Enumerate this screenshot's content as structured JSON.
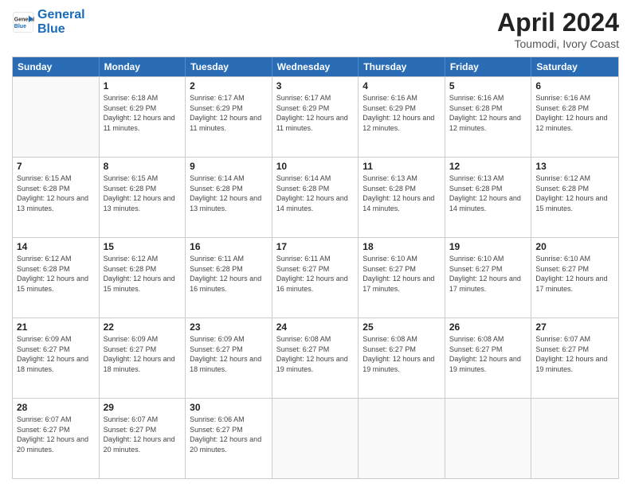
{
  "logo": {
    "line1": "General",
    "line2": "Blue"
  },
  "title": {
    "month": "April 2024",
    "location": "Toumodi, Ivory Coast"
  },
  "header_days": [
    "Sunday",
    "Monday",
    "Tuesday",
    "Wednesday",
    "Thursday",
    "Friday",
    "Saturday"
  ],
  "weeks": [
    [
      {
        "day": "",
        "sunrise": "",
        "sunset": "",
        "daylight": ""
      },
      {
        "day": "1",
        "sunrise": "6:18 AM",
        "sunset": "6:29 PM",
        "daylight": "12 hours and 11 minutes."
      },
      {
        "day": "2",
        "sunrise": "6:17 AM",
        "sunset": "6:29 PM",
        "daylight": "12 hours and 11 minutes."
      },
      {
        "day": "3",
        "sunrise": "6:17 AM",
        "sunset": "6:29 PM",
        "daylight": "12 hours and 11 minutes."
      },
      {
        "day": "4",
        "sunrise": "6:16 AM",
        "sunset": "6:29 PM",
        "daylight": "12 hours and 12 minutes."
      },
      {
        "day": "5",
        "sunrise": "6:16 AM",
        "sunset": "6:28 PM",
        "daylight": "12 hours and 12 minutes."
      },
      {
        "day": "6",
        "sunrise": "6:16 AM",
        "sunset": "6:28 PM",
        "daylight": "12 hours and 12 minutes."
      }
    ],
    [
      {
        "day": "7",
        "sunrise": "6:15 AM",
        "sunset": "6:28 PM",
        "daylight": "12 hours and 13 minutes."
      },
      {
        "day": "8",
        "sunrise": "6:15 AM",
        "sunset": "6:28 PM",
        "daylight": "12 hours and 13 minutes."
      },
      {
        "day": "9",
        "sunrise": "6:14 AM",
        "sunset": "6:28 PM",
        "daylight": "12 hours and 13 minutes."
      },
      {
        "day": "10",
        "sunrise": "6:14 AM",
        "sunset": "6:28 PM",
        "daylight": "12 hours and 14 minutes."
      },
      {
        "day": "11",
        "sunrise": "6:13 AM",
        "sunset": "6:28 PM",
        "daylight": "12 hours and 14 minutes."
      },
      {
        "day": "12",
        "sunrise": "6:13 AM",
        "sunset": "6:28 PM",
        "daylight": "12 hours and 14 minutes."
      },
      {
        "day": "13",
        "sunrise": "6:12 AM",
        "sunset": "6:28 PM",
        "daylight": "12 hours and 15 minutes."
      }
    ],
    [
      {
        "day": "14",
        "sunrise": "6:12 AM",
        "sunset": "6:28 PM",
        "daylight": "12 hours and 15 minutes."
      },
      {
        "day": "15",
        "sunrise": "6:12 AM",
        "sunset": "6:28 PM",
        "daylight": "12 hours and 15 minutes."
      },
      {
        "day": "16",
        "sunrise": "6:11 AM",
        "sunset": "6:28 PM",
        "daylight": "12 hours and 16 minutes."
      },
      {
        "day": "17",
        "sunrise": "6:11 AM",
        "sunset": "6:27 PM",
        "daylight": "12 hours and 16 minutes."
      },
      {
        "day": "18",
        "sunrise": "6:10 AM",
        "sunset": "6:27 PM",
        "daylight": "12 hours and 17 minutes."
      },
      {
        "day": "19",
        "sunrise": "6:10 AM",
        "sunset": "6:27 PM",
        "daylight": "12 hours and 17 minutes."
      },
      {
        "day": "20",
        "sunrise": "6:10 AM",
        "sunset": "6:27 PM",
        "daylight": "12 hours and 17 minutes."
      }
    ],
    [
      {
        "day": "21",
        "sunrise": "6:09 AM",
        "sunset": "6:27 PM",
        "daylight": "12 hours and 18 minutes."
      },
      {
        "day": "22",
        "sunrise": "6:09 AM",
        "sunset": "6:27 PM",
        "daylight": "12 hours and 18 minutes."
      },
      {
        "day": "23",
        "sunrise": "6:09 AM",
        "sunset": "6:27 PM",
        "daylight": "12 hours and 18 minutes."
      },
      {
        "day": "24",
        "sunrise": "6:08 AM",
        "sunset": "6:27 PM",
        "daylight": "12 hours and 19 minutes."
      },
      {
        "day": "25",
        "sunrise": "6:08 AM",
        "sunset": "6:27 PM",
        "daylight": "12 hours and 19 minutes."
      },
      {
        "day": "26",
        "sunrise": "6:08 AM",
        "sunset": "6:27 PM",
        "daylight": "12 hours and 19 minutes."
      },
      {
        "day": "27",
        "sunrise": "6:07 AM",
        "sunset": "6:27 PM",
        "daylight": "12 hours and 19 minutes."
      }
    ],
    [
      {
        "day": "28",
        "sunrise": "6:07 AM",
        "sunset": "6:27 PM",
        "daylight": "12 hours and 20 minutes."
      },
      {
        "day": "29",
        "sunrise": "6:07 AM",
        "sunset": "6:27 PM",
        "daylight": "12 hours and 20 minutes."
      },
      {
        "day": "30",
        "sunrise": "6:06 AM",
        "sunset": "6:27 PM",
        "daylight": "12 hours and 20 minutes."
      },
      {
        "day": "",
        "sunrise": "",
        "sunset": "",
        "daylight": ""
      },
      {
        "day": "",
        "sunrise": "",
        "sunset": "",
        "daylight": ""
      },
      {
        "day": "",
        "sunrise": "",
        "sunset": "",
        "daylight": ""
      },
      {
        "day": "",
        "sunrise": "",
        "sunset": "",
        "daylight": ""
      }
    ]
  ]
}
